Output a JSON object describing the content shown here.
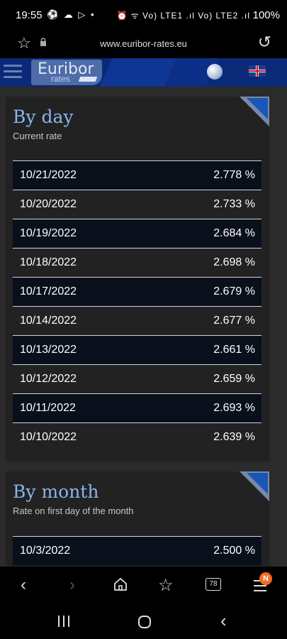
{
  "status_bar": {
    "time": "19:55",
    "left_icons": "⚽ ☁ ▷ •",
    "right_icons": "⏰ ᯤ Vo) LTE1 .ıl Vo) LTE2 .ıl",
    "battery": "100%"
  },
  "browser": {
    "url": "www.euribor-rates.eu"
  },
  "site": {
    "logo_text": "Euribor",
    "logo_sub": "rates"
  },
  "by_day": {
    "title": "By day",
    "subtitle": "Current rate",
    "rows": [
      {
        "date": "10/21/2022",
        "rate": "2.778 %"
      },
      {
        "date": "10/20/2022",
        "rate": "2.733 %"
      },
      {
        "date": "10/19/2022",
        "rate": "2.684 %"
      },
      {
        "date": "10/18/2022",
        "rate": "2.698 %"
      },
      {
        "date": "10/17/2022",
        "rate": "2.679 %"
      },
      {
        "date": "10/14/2022",
        "rate": "2.677 %"
      },
      {
        "date": "10/13/2022",
        "rate": "2.661 %"
      },
      {
        "date": "10/12/2022",
        "rate": "2.659 %"
      },
      {
        "date": "10/11/2022",
        "rate": "2.693 %"
      },
      {
        "date": "10/10/2022",
        "rate": "2.639 %"
      }
    ]
  },
  "by_month": {
    "title": "By month",
    "subtitle": "Rate on first day of the month",
    "rows": [
      {
        "date": "10/3/2022",
        "rate": "2.500 %"
      }
    ]
  },
  "toolbar": {
    "tabs_count": "78",
    "menu_badge": "N"
  }
}
